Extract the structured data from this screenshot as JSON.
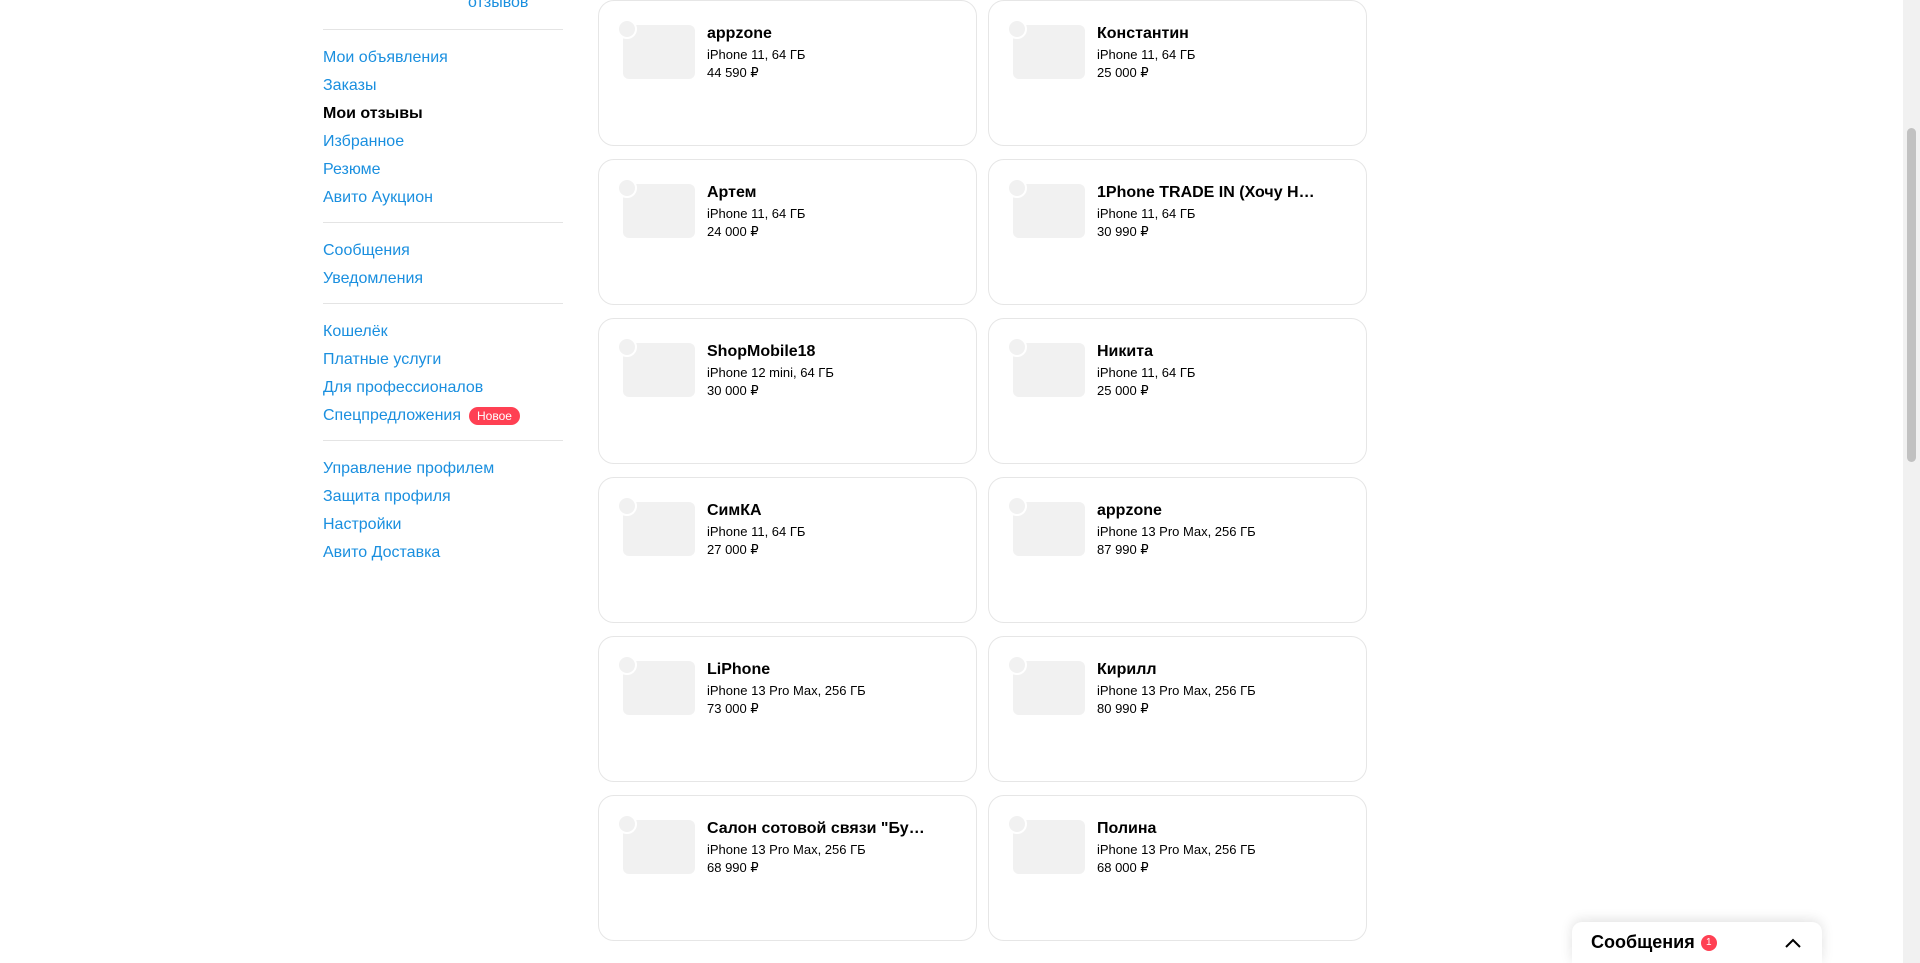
{
  "sidebar": {
    "reviews_link": "отзывов",
    "groups": [
      [
        {
          "label": "Мои объявления",
          "active": false
        },
        {
          "label": "Заказы",
          "active": false
        },
        {
          "label": "Мои отзывы",
          "active": true
        },
        {
          "label": "Избранное",
          "active": false
        },
        {
          "label": "Резюме",
          "active": false
        },
        {
          "label": "Авито Аукцион",
          "active": false
        }
      ],
      [
        {
          "label": "Сообщения",
          "active": false
        },
        {
          "label": "Уведомления",
          "active": false
        }
      ],
      [
        {
          "label": "Кошелёк",
          "active": false
        },
        {
          "label": "Платные услуги",
          "active": false
        },
        {
          "label": "Для профессионалов",
          "active": false
        },
        {
          "label": "Спецпредложения",
          "active": false,
          "badge": "Новое"
        }
      ],
      [
        {
          "label": "Управление профилем",
          "active": false
        },
        {
          "label": "Защита профиля",
          "active": false
        },
        {
          "label": "Настройки",
          "active": false
        },
        {
          "label": "Авито Доставка",
          "active": false
        }
      ]
    ]
  },
  "cards": [
    {
      "name": "appzone",
      "model": "iPhone 11, 64 ГБ",
      "price": "44 590 ₽"
    },
    {
      "name": "Константин",
      "model": "iPhone 11, 64 ГБ",
      "price": "25 000 ₽"
    },
    {
      "name": "Артем",
      "model": "iPhone 11, 64 ГБ",
      "price": "24 000 ₽"
    },
    {
      "name": "1Phone TRADE IN (Хочу Ho…",
      "model": "iPhone 11, 64 ГБ",
      "price": "30 990 ₽"
    },
    {
      "name": "ShopMobile18",
      "model": "iPhone 12 mini, 64 ГБ",
      "price": "30 000 ₽"
    },
    {
      "name": "Никита",
      "model": "iPhone 11, 64 ГБ",
      "price": "25 000 ₽"
    },
    {
      "name": "СимКА",
      "model": "iPhone 11, 64 ГБ",
      "price": "27 000 ₽"
    },
    {
      "name": "appzone",
      "model": "iPhone 13 Pro Max, 256 ГБ",
      "price": "87 990 ₽"
    },
    {
      "name": "LiPhone",
      "model": "iPhone 13 Pro Max, 256 ГБ",
      "price": "73 000 ₽"
    },
    {
      "name": "Кирилл",
      "model": "iPhone 13 Pro Max, 256 ГБ",
      "price": "80 990 ₽"
    },
    {
      "name": "Салон сотовой связи \"Бу…",
      "model": "iPhone 13 Pro Max, 256 ГБ",
      "price": "68 990 ₽"
    },
    {
      "name": "Полина",
      "model": "iPhone 13 Pro Max, 256 ГБ",
      "price": "68 000 ₽"
    }
  ],
  "messenger": {
    "title": "Сообщения",
    "count": "1",
    "icon": "chevron-up-icon"
  },
  "colors": {
    "link": "#1a8fdf",
    "badge": "#ff4053",
    "border": "#e6e6e6",
    "placeholder": "#f1f1f1"
  }
}
